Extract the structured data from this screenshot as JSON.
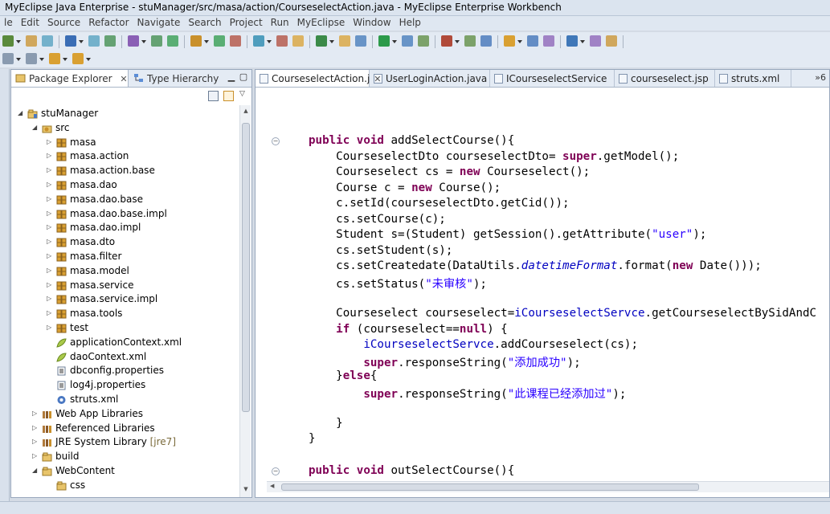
{
  "window": {
    "title": "MyEclipse Java Enterprise - stuManager/src/masa/action/CourseselectAction.java - MyEclipse Enterprise Workbench"
  },
  "menu": [
    "le",
    "Edit",
    "Source",
    "Refactor",
    "Navigate",
    "Search",
    "Project",
    "Run",
    "MyEclipse",
    "Window",
    "Help"
  ],
  "toolbar": {
    "row1_icons": [
      "new-icon",
      "save-icon",
      "print-icon",
      "package-icon",
      "server-icon",
      "debug-icon",
      "run-icon",
      "external-tools-icon",
      "grid-icon",
      "search-icon"
    ],
    "row2_icons": [
      "next-annotation-icon",
      "prev-annotation-icon",
      "back-icon",
      "forward-icon"
    ]
  },
  "explorer": {
    "tabs": [
      {
        "label": "Package Explorer",
        "close": "✕"
      },
      {
        "label": "Type Hierarchy"
      }
    ],
    "tree": [
      {
        "label": "stuManager",
        "depth": 1,
        "icon": "project",
        "twisty": "open"
      },
      {
        "label": "src",
        "depth": 2,
        "icon": "srcfolder",
        "twisty": "open"
      },
      {
        "label": "masa",
        "depth": 3,
        "icon": "package",
        "twisty": "closed"
      },
      {
        "label": "masa.action",
        "depth": 3,
        "icon": "package",
        "twisty": "closed"
      },
      {
        "label": "masa.action.base",
        "depth": 3,
        "icon": "package",
        "twisty": "closed"
      },
      {
        "label": "masa.dao",
        "depth": 3,
        "icon": "package",
        "twisty": "closed"
      },
      {
        "label": "masa.dao.base",
        "depth": 3,
        "icon": "package",
        "twisty": "closed"
      },
      {
        "label": "masa.dao.base.impl",
        "depth": 3,
        "icon": "package",
        "twisty": "closed"
      },
      {
        "label": "masa.dao.impl",
        "depth": 3,
        "icon": "package",
        "twisty": "closed"
      },
      {
        "label": "masa.dto",
        "depth": 3,
        "icon": "package",
        "twisty": "closed"
      },
      {
        "label": "masa.filter",
        "depth": 3,
        "icon": "package",
        "twisty": "closed"
      },
      {
        "label": "masa.model",
        "depth": 3,
        "icon": "package",
        "twisty": "closed"
      },
      {
        "label": "masa.service",
        "depth": 3,
        "icon": "package",
        "twisty": "closed"
      },
      {
        "label": "masa.service.impl",
        "depth": 3,
        "icon": "package",
        "twisty": "closed"
      },
      {
        "label": "masa.tools",
        "depth": 3,
        "icon": "package",
        "twisty": "closed"
      },
      {
        "label": "test",
        "depth": 3,
        "icon": "package",
        "twisty": "closed"
      },
      {
        "label": "applicationContext.xml",
        "depth": 3,
        "icon": "leaf",
        "twisty": "none"
      },
      {
        "label": "daoContext.xml",
        "depth": 3,
        "icon": "leaf",
        "twisty": "none"
      },
      {
        "label": "dbconfig.properties",
        "depth": 3,
        "icon": "props",
        "twisty": "none"
      },
      {
        "label": "log4j.properties",
        "depth": 3,
        "icon": "props",
        "twisty": "none"
      },
      {
        "label": "struts.xml",
        "depth": 3,
        "icon": "gear",
        "twisty": "none"
      },
      {
        "label": "Web App Libraries",
        "depth": 2,
        "icon": "library",
        "twisty": "closed"
      },
      {
        "label": "Referenced Libraries",
        "depth": 2,
        "icon": "library",
        "twisty": "closed"
      },
      {
        "label": "JRE System Library",
        "suffix": " [jre7]",
        "depth": 2,
        "icon": "library",
        "twisty": "closed"
      },
      {
        "label": "build",
        "depth": 2,
        "icon": "folder",
        "twisty": "closed"
      },
      {
        "label": "WebContent",
        "depth": 2,
        "icon": "folder",
        "twisty": "open"
      },
      {
        "label": "css",
        "depth": 3,
        "icon": "folder",
        "twisty": "none"
      }
    ]
  },
  "editor": {
    "tabs": [
      {
        "label": "CourseselectAction.j",
        "close": "✕",
        "active": true
      },
      {
        "label": "UserLoginAction.java"
      },
      {
        "label": "ICourseselectService"
      },
      {
        "label": "courseselect.jsp"
      },
      {
        "label": "struts.xml"
      }
    ],
    "overflow": "»6",
    "lines": [
      [
        [
          "kw",
          "public "
        ],
        [
          "kw",
          "void "
        ],
        [
          "t",
          "addSelectCourse(){"
        ]
      ],
      [
        [
          "t",
          "    CourseselectDto courseselectDto= "
        ],
        [
          "kw",
          "super"
        ],
        [
          "t",
          ".getModel();"
        ]
      ],
      [
        [
          "t",
          "    Courseselect cs = "
        ],
        [
          "kw",
          "new "
        ],
        [
          "t",
          "Courseselect();"
        ]
      ],
      [
        [
          "t",
          "    Course c = "
        ],
        [
          "kw",
          "new "
        ],
        [
          "t",
          "Course();"
        ]
      ],
      [
        [
          "t",
          "    c.setId(courseselectDto.getCid());"
        ]
      ],
      [
        [
          "t",
          "    cs.setCourse(c);"
        ]
      ],
      [
        [
          "t",
          "    Student s=(Student) getSession().getAttribute("
        ],
        [
          "str",
          "\"user\""
        ],
        [
          "t",
          ");"
        ]
      ],
      [
        [
          "t",
          "    cs.setStudent(s);"
        ]
      ],
      [
        [
          "t",
          "    cs.setCreatedate(DataUtils."
        ],
        [
          "sfld",
          "datetimeFormat"
        ],
        [
          "t",
          ".format("
        ],
        [
          "kw",
          "new "
        ],
        [
          "t",
          "Date()));"
        ]
      ],
      [
        [
          "t",
          "    cs.setStatus("
        ],
        [
          "str",
          "\"未审核\""
        ],
        [
          "t",
          ");"
        ]
      ],
      [
        [
          "t",
          ""
        ]
      ],
      [
        [
          "t",
          "    Courseselect courseselect="
        ],
        [
          "fld",
          "iCourseselectServce"
        ],
        [
          "t",
          ".getCourseselectBySidAndC"
        ]
      ],
      [
        [
          "t",
          "    "
        ],
        [
          "kw",
          "if "
        ],
        [
          "t",
          "(courseselect=="
        ],
        [
          "kw",
          "null"
        ],
        [
          "t",
          ") {"
        ]
      ],
      [
        [
          "t",
          "        "
        ],
        [
          "fld",
          "iCourseselectServce"
        ],
        [
          "t",
          ".addCourseselect(cs);"
        ]
      ],
      [
        [
          "t",
          "        "
        ],
        [
          "kw",
          "super"
        ],
        [
          "t",
          ".responseString("
        ],
        [
          "str",
          "\"添加成功\""
        ],
        [
          "t",
          ");"
        ]
      ],
      [
        [
          "t",
          "    }"
        ],
        [
          "kw",
          "else"
        ],
        [
          "t",
          "{"
        ]
      ],
      [
        [
          "t",
          "        "
        ],
        [
          "kw",
          "super"
        ],
        [
          "t",
          ".responseString("
        ],
        [
          "str",
          "\"此课程已经添加过\""
        ],
        [
          "t",
          ");"
        ]
      ],
      [
        [
          "t",
          ""
        ]
      ],
      [
        [
          "t",
          "    }"
        ]
      ],
      [
        [
          "t",
          "}"
        ]
      ],
      [
        [
          "t",
          ""
        ]
      ],
      [
        [
          "kw",
          "public "
        ],
        [
          "kw",
          "void "
        ],
        [
          "t",
          "outSelectCourse(){"
        ]
      ]
    ]
  },
  "colors": {
    "keyword": "#7f0055",
    "string": "#2a00ff",
    "field": "#0000c0",
    "package_icon": "#c9902b"
  }
}
